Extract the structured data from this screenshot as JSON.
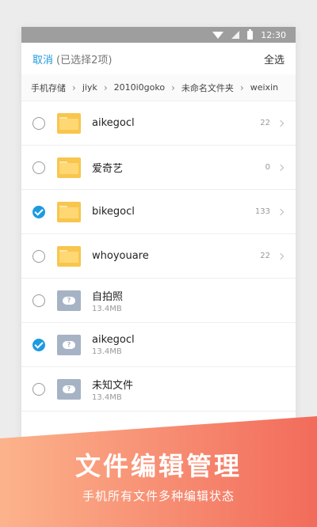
{
  "statusbar": {
    "time": "12:30"
  },
  "toolbar": {
    "cancel_label": "取消",
    "selected_label": "(已选择2项)",
    "select_all_label": "全选"
  },
  "breadcrumb": [
    "手机存储",
    "jiyk",
    "2010i0goko",
    "未命名文件夹",
    "weixin"
  ],
  "rows": [
    {
      "type": "folder",
      "name": "aikegocl",
      "count": "22",
      "checked": false
    },
    {
      "type": "folder",
      "name": "爱奇艺",
      "count": "0",
      "checked": false
    },
    {
      "type": "folder",
      "name": "bikegocl",
      "count": "133",
      "checked": true
    },
    {
      "type": "folder",
      "name": "whoyouare",
      "count": "22",
      "checked": false
    },
    {
      "type": "file",
      "name": "自拍照",
      "size": "13.4MB",
      "checked": false
    },
    {
      "type": "file",
      "name": "aikegocl",
      "size": "13.4MB",
      "checked": true
    },
    {
      "type": "file",
      "name": "未知文件",
      "size": "13.4MB",
      "checked": false
    }
  ],
  "banner": {
    "title": "文件编辑管理",
    "subtitle": "手机所有文件多种编辑状态"
  },
  "colors": {
    "accent": "#1e9ae0",
    "banner_start": "#fcb38c",
    "banner_end": "#f26b5b",
    "folder": "#f8c64e"
  }
}
